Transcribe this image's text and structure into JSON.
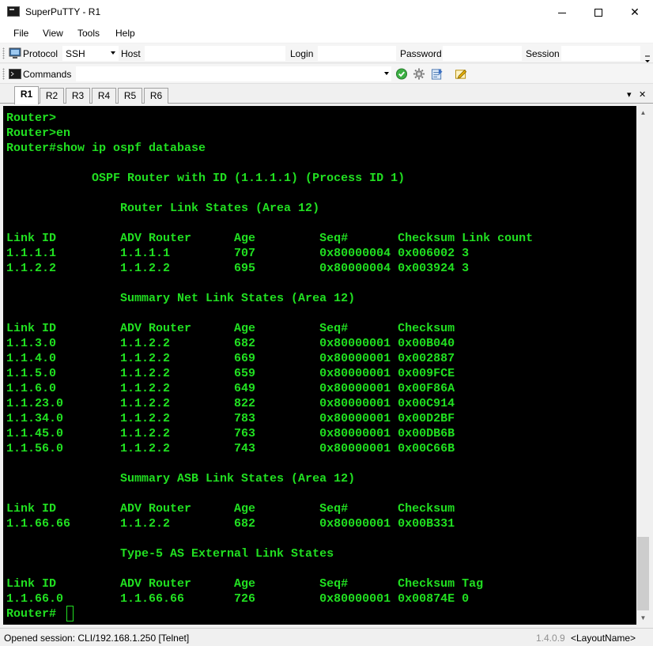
{
  "window": {
    "title": "SuperPuTTY - R1",
    "min_glyph": "minimize",
    "max_glyph": "maximize",
    "close_glyph": "✕"
  },
  "menu": [
    "File",
    "View",
    "Tools",
    "Help"
  ],
  "connection_bar": {
    "protocol_label": "Protocol",
    "protocol_value": "SSH",
    "host_label": "Host",
    "login_label": "Login",
    "password_label": "Password",
    "session_label": "Session"
  },
  "commands_bar": {
    "label": "Commands"
  },
  "tabs": [
    "R1",
    "R2",
    "R3",
    "R4",
    "R5",
    "R6"
  ],
  "active_tab": "R1",
  "tab_controls": {
    "list": "▾",
    "close": "✕"
  },
  "terminal": {
    "lines": [
      "Router>",
      "Router>en",
      "Router#show ip ospf database",
      "",
      "            OSPF Router with ID (1.1.1.1) (Process ID 1)",
      "",
      "                Router Link States (Area 12)",
      "",
      "Link ID         ADV Router      Age         Seq#       Checksum Link count",
      "1.1.1.1         1.1.1.1         707         0x80000004 0x006002 3",
      "1.1.2.2         1.1.2.2         695         0x80000004 0x003924 3",
      "",
      "                Summary Net Link States (Area 12)",
      "",
      "Link ID         ADV Router      Age         Seq#       Checksum",
      "1.1.3.0         1.1.2.2         682         0x80000001 0x00B040",
      "1.1.4.0         1.1.2.2         669         0x80000001 0x002887",
      "1.1.5.0         1.1.2.2         659         0x80000001 0x009FCE",
      "1.1.6.0         1.1.2.2         649         0x80000001 0x00F86A",
      "1.1.23.0        1.1.2.2         822         0x80000001 0x00C914",
      "1.1.34.0        1.1.2.2         783         0x80000001 0x00D2BF",
      "1.1.45.0        1.1.2.2         763         0x80000001 0x00DB6B",
      "1.1.56.0        1.1.2.2         743         0x80000001 0x00C66B",
      "",
      "                Summary ASB Link States (Area 12)",
      "",
      "Link ID         ADV Router      Age         Seq#       Checksum",
      "1.1.66.66       1.1.2.2         682         0x80000001 0x00B331",
      "",
      "                Type-5 AS External Link States",
      "",
      "Link ID         ADV Router      Age         Seq#       Checksum Tag",
      "1.1.66.0        1.1.66.66       726         0x80000001 0x00874E 0",
      "Router#"
    ]
  },
  "status": {
    "message": "Opened session: CLI/192.168.1.250 [Telnet]",
    "version": "1.4.0.9",
    "layout": "<LayoutName>"
  },
  "colors": {
    "terminal_bg": "#000000",
    "terminal_fg": "#21e021"
  }
}
